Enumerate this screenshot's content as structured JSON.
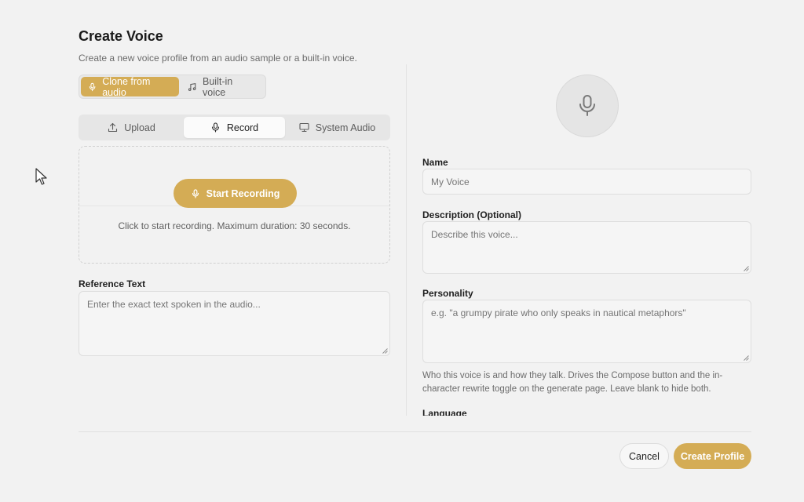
{
  "header": {
    "title": "Create Voice",
    "subtitle": "Create a new voice profile from an audio sample or a built-in voice."
  },
  "mode_toggle": {
    "clone_label": "Clone from audio",
    "builtin_label": "Built-in voice",
    "active": "clone"
  },
  "source_tabs": {
    "upload_label": "Upload",
    "record_label": "Record",
    "system_audio_label": "System Audio",
    "active": "record"
  },
  "recorder": {
    "button_label": "Start Recording",
    "hint": "Click to start recording. Maximum duration: 30 seconds."
  },
  "reference_text": {
    "label": "Reference Text",
    "placeholder": "Enter the exact text spoken in the audio..."
  },
  "profile": {
    "name_label": "Name",
    "name_placeholder": "My Voice",
    "description_label": "Description (Optional)",
    "description_placeholder": "Describe this voice...",
    "personality_label": "Personality",
    "personality_placeholder": "e.g. \"a grumpy pirate who only speaks in nautical metaphors\"",
    "personality_helper": "Who this voice is and how they talk. Drives the Compose button and the in-character rewrite toggle on the generate page. Leave blank to hide both.",
    "language_label": "Language"
  },
  "footer": {
    "cancel_label": "Cancel",
    "create_label": "Create Profile"
  },
  "colors": {
    "accent": "#d4ac55",
    "background": "#f2f2f2"
  },
  "icons": {
    "clone": "mic-icon",
    "builtin": "music-note-icon",
    "upload": "upload-icon",
    "record": "mic-icon",
    "system_audio": "monitor-icon",
    "avatar": "mic-icon"
  }
}
